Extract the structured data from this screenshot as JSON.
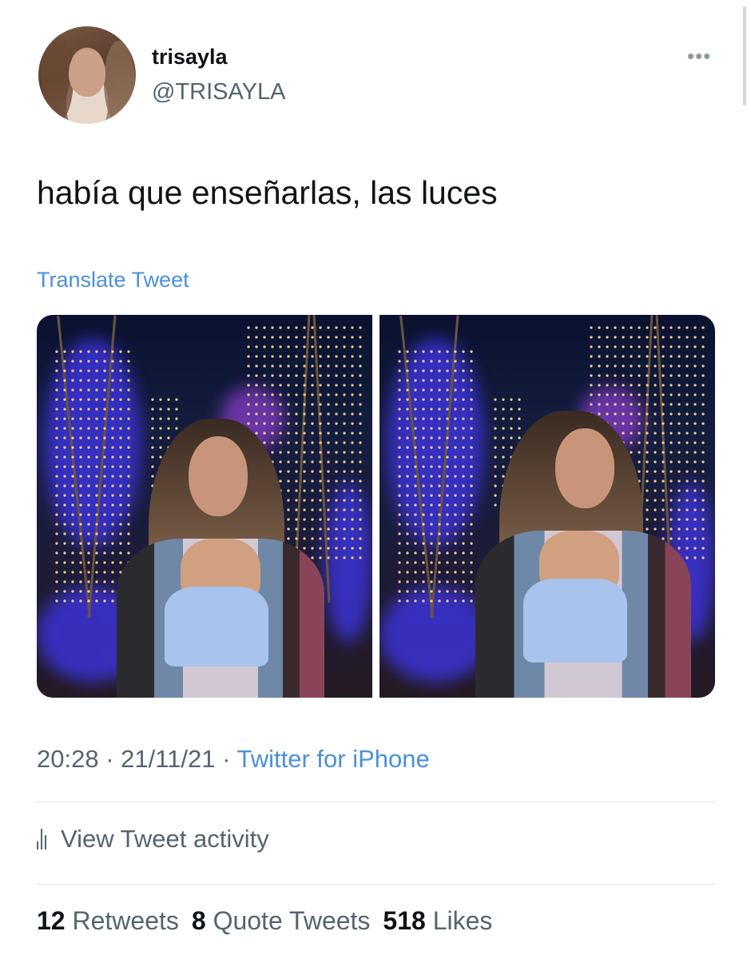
{
  "author": {
    "display_name": "trisayla",
    "handle": "@TRISAYLA"
  },
  "tweet": {
    "text": "había que enseñarlas, las luces",
    "translate_label": "Translate Tweet"
  },
  "meta": {
    "time": "20:28",
    "date": "21/11/21",
    "separator": " · ",
    "source": "Twitter for iPhone"
  },
  "activity": {
    "label": "View Tweet activity"
  },
  "stats": {
    "retweets_count": "12",
    "retweets_label": "Retweets",
    "quotes_count": "8",
    "quotes_label": "Quote Tweets",
    "likes_count": "518",
    "likes_label": "Likes"
  },
  "icons": {
    "more": "more-icon",
    "activity": "bar-chart-icon"
  },
  "colors": {
    "link": "#4a90d9",
    "secondary_text": "#536471",
    "primary_text": "#0f1419"
  }
}
